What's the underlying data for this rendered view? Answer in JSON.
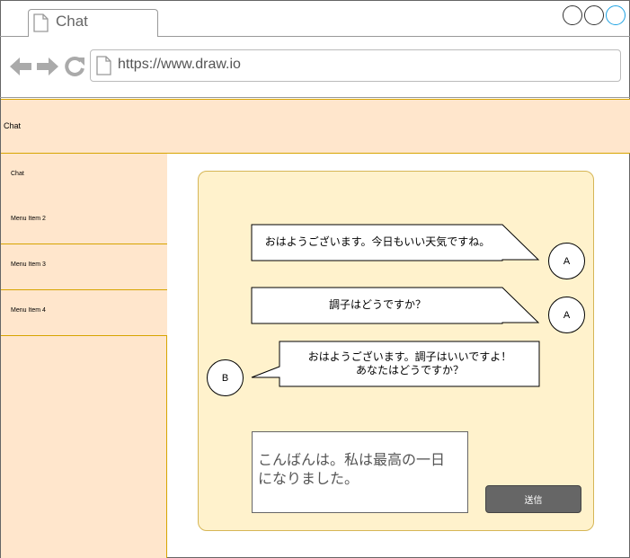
{
  "browser": {
    "tab_title": "Chat",
    "url": "https://www.draw.io"
  },
  "app": {
    "header_title": "Chat"
  },
  "sidebar": {
    "items": [
      {
        "label": "Chat"
      },
      {
        "label": "Menu Item 2"
      },
      {
        "label": "Menu Item 3"
      },
      {
        "label": "Menu Item 4"
      }
    ]
  },
  "chat": {
    "messages": [
      {
        "sender": "A",
        "lines": [
          "おはようございます。今日もいい天気ですね。"
        ]
      },
      {
        "sender": "A",
        "lines": [
          "調子はどうですか？"
        ]
      },
      {
        "sender": "B",
        "lines": [
          "おはようございます。調子はいいですよ！",
          "あなたはどうですか？"
        ]
      }
    ],
    "input_lines": [
      "こんばんは。私は最高の一日",
      "になりました。"
    ],
    "send_label": "送信"
  },
  "colors": {
    "header_bg": "#ffe6cc",
    "sidebar_border": "#d7a400",
    "panel_bg": "#fff2cc",
    "panel_border": "#d6b656",
    "send_button_bg": "#666666",
    "window_button_accent": "#1ba1e2"
  },
  "icons": {
    "tab": "page-icon",
    "back": "back-arrow-icon",
    "forward": "forward-arrow-icon",
    "reload": "reload-icon",
    "address": "page-icon"
  }
}
